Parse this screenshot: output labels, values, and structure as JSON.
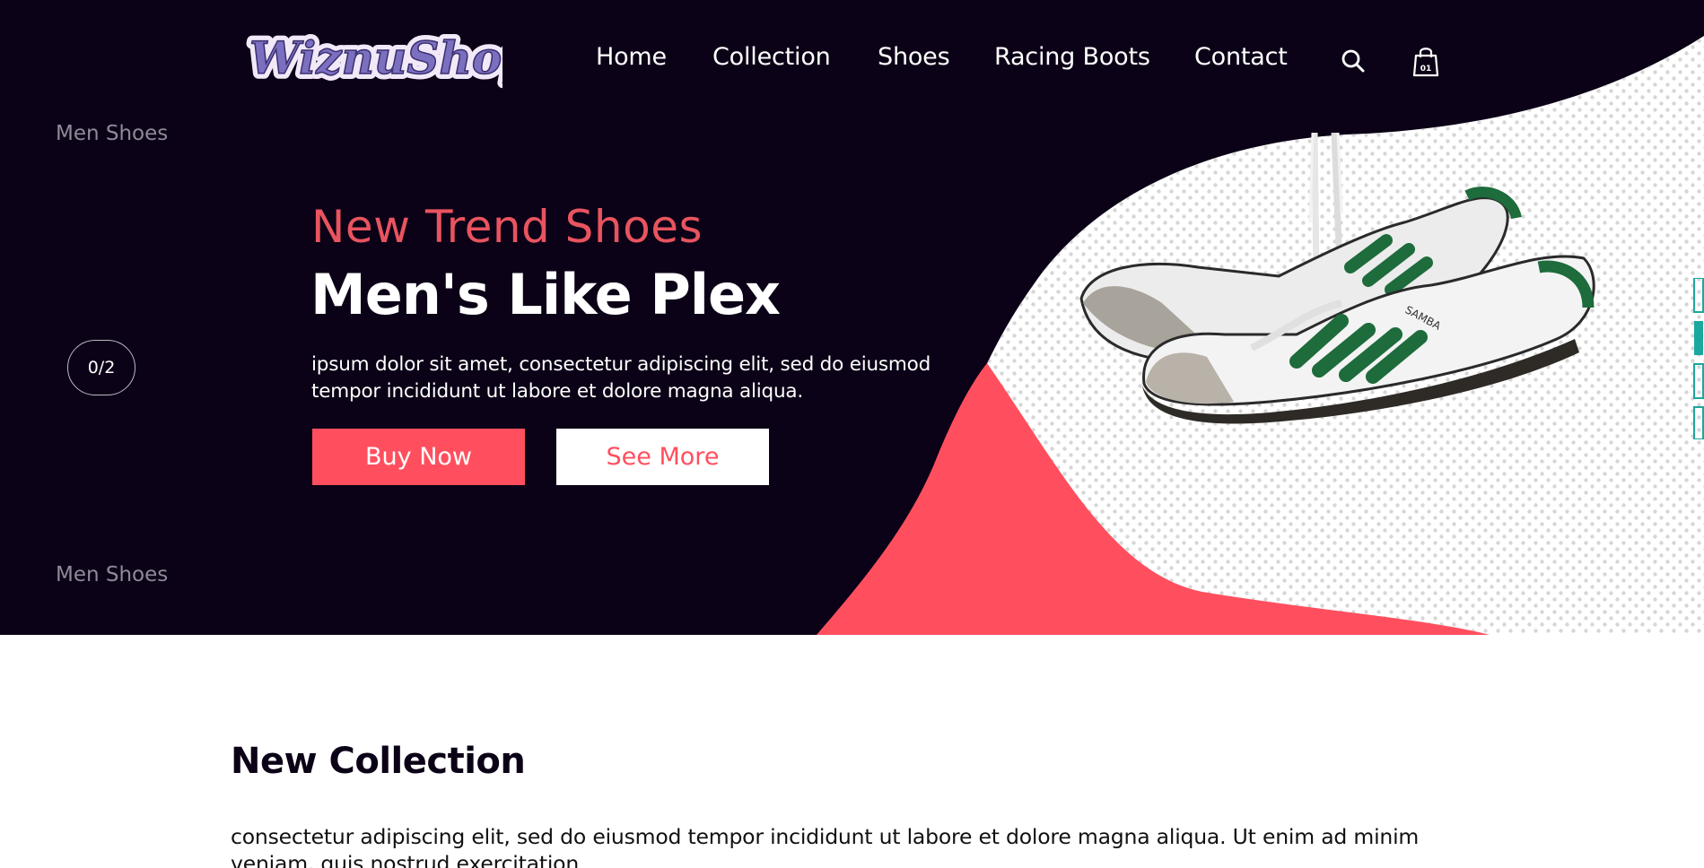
{
  "brand": {
    "logo_text": "WiznuShop"
  },
  "nav": {
    "items": [
      {
        "label": "Home"
      },
      {
        "label": "Collection"
      },
      {
        "label": "Shoes"
      },
      {
        "label": "Racing Boots"
      },
      {
        "label": "Contact"
      }
    ],
    "search_icon": "search-icon",
    "cart_icon": "shopping-bag-icon",
    "cart_count": "01"
  },
  "hero": {
    "side_label_top": "Men Shoes",
    "side_label_bottom": "Men Shoes",
    "pager": "0/2",
    "subtitle": "New Trend Shoes",
    "title": "Men's Like Plex",
    "description": "ipsum dolor sit amet, consectetur adipiscing elit, sed do eiusmod tempor incididunt ut labore et dolore magna aliqua.",
    "buy_label": "Buy Now",
    "more_label": "See More",
    "shoe_text": "SAMBA"
  },
  "collection": {
    "title": "New Collection",
    "text": "consectetur adipiscing elit, sed do eiusmod tempor incididunt ut labore et dolore magna aliqua. Ut enim ad minim veniam, quis nostrud exercitation"
  },
  "colors": {
    "hero_bg": "#0c0217",
    "accent": "#ff4f5e",
    "logo_fill": "#7b6fc0",
    "logo_outline": "#f1e9f8"
  }
}
